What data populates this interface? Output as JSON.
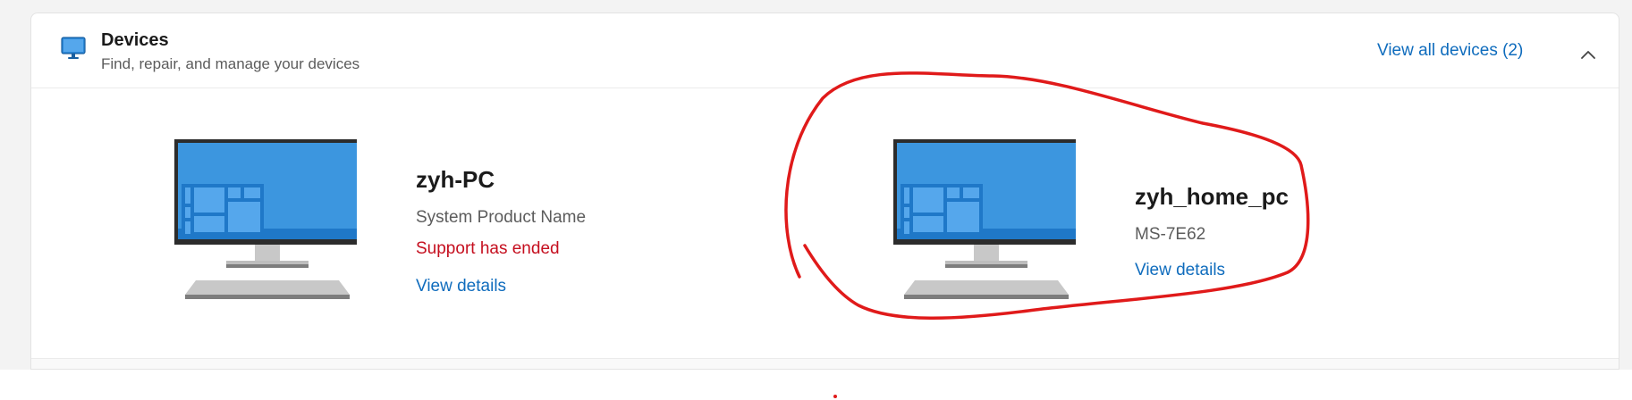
{
  "header": {
    "icon": "monitor-icon",
    "title": "Devices",
    "subtitle": "Find, repair, and manage your devices",
    "view_all_label": "View all devices (2)",
    "collapse_icon": "chevron-up-icon"
  },
  "devices": [
    {
      "name": "zyh-PC",
      "model": "System Product Name",
      "support_status": "Support has ended",
      "link_label": "View details",
      "icon": "desktop-pc-icon"
    },
    {
      "name": "zyh_home_pc",
      "model": "MS-7E62",
      "link_label": "View details",
      "icon": "desktop-pc-icon"
    }
  ],
  "colors": {
    "accent": "#0f6cbd",
    "error": "#c50f1f",
    "annotation": "#e01a1a"
  }
}
